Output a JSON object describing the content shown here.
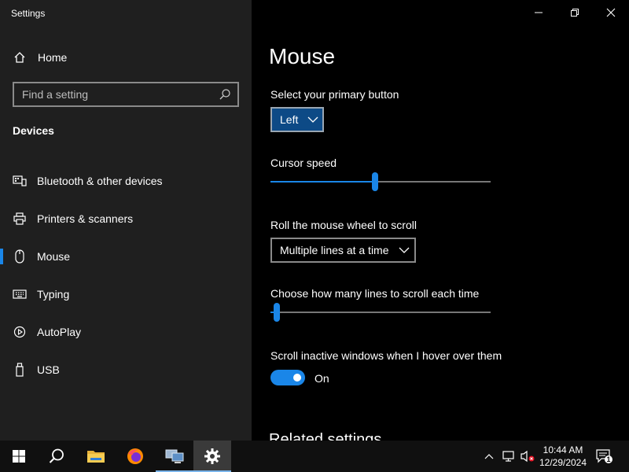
{
  "window": {
    "title": "Settings",
    "minimize_icon": "minimize-icon",
    "maximize_icon": "restore-icon",
    "close_icon": "close-icon"
  },
  "sidebar": {
    "home_label": "Home",
    "search_placeholder": "Find a setting",
    "section_title": "Devices",
    "items": [
      {
        "label": "Bluetooth & other devices",
        "icon": "bluetooth-devices-icon"
      },
      {
        "label": "Printers & scanners",
        "icon": "printer-icon"
      },
      {
        "label": "Mouse",
        "icon": "mouse-icon",
        "active": true
      },
      {
        "label": "Typing",
        "icon": "keyboard-icon"
      },
      {
        "label": "AutoPlay",
        "icon": "autoplay-icon"
      },
      {
        "label": "USB",
        "icon": "usb-icon"
      }
    ]
  },
  "main": {
    "title": "Mouse",
    "primary_button_label": "Select your primary button",
    "primary_button_value": "Left",
    "cursor_speed_label": "Cursor speed",
    "cursor_speed_percent": 47.5,
    "scroll_label": "Roll the mouse wheel to scroll",
    "scroll_value": "Multiple lines at a time",
    "lines_label": "Choose how many lines to scroll each time",
    "lines_percent": 3,
    "inactive_label": "Scroll inactive windows when I hover over them",
    "inactive_state": "On",
    "related_title": "Related settings"
  },
  "taskbar": {
    "time": "10:44 AM",
    "date": "12/29/2024",
    "notification_count": "1",
    "accent": "#1a86e8"
  }
}
